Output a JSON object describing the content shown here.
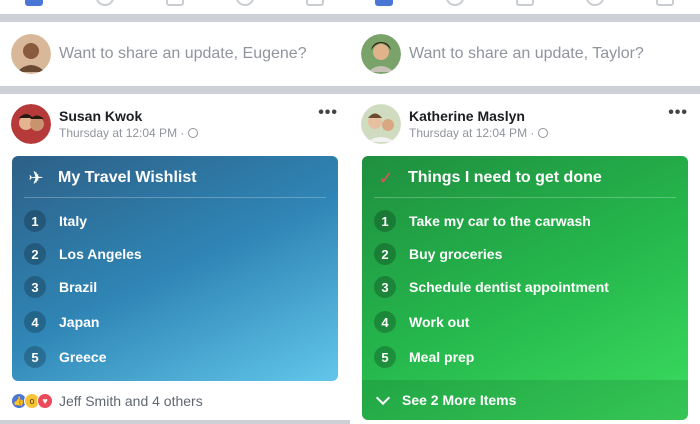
{
  "left_screen": {
    "composer": {
      "placeholder": "Want to share an update, Eugene?"
    },
    "post": {
      "author": "Susan Kwok",
      "meta": "Thursday at 12:04 PM ·",
      "more": "•••",
      "list": {
        "title": "My Travel Wishlist",
        "icon": "airplane-icon",
        "color": "#2f85b5",
        "items": [
          {
            "num": "1",
            "text": "Italy"
          },
          {
            "num": "2",
            "text": "Los Angeles"
          },
          {
            "num": "3",
            "text": "Brazil"
          },
          {
            "num": "4",
            "text": "Japan"
          },
          {
            "num": "5",
            "text": "Greece"
          }
        ]
      },
      "reactions": "Jeff Smith and 4 others"
    }
  },
  "right_screen": {
    "composer": {
      "placeholder": "Want to share an update, Taylor?"
    },
    "post": {
      "author": "Katherine Maslyn",
      "meta": "Thursday at 12:04 PM ·",
      "more": "•••",
      "list": {
        "title": "Things I need to get done",
        "icon": "checkmark-icon",
        "color": "#25b64c",
        "items": [
          {
            "num": "1",
            "text": "Take my car to the carwash"
          },
          {
            "num": "2",
            "text": "Buy groceries"
          },
          {
            "num": "3",
            "text": "Schedule dentist appointment"
          },
          {
            "num": "4",
            "text": "Work out"
          },
          {
            "num": "5",
            "text": "Meal prep"
          }
        ],
        "see_more": "See 2 More Items"
      }
    }
  }
}
